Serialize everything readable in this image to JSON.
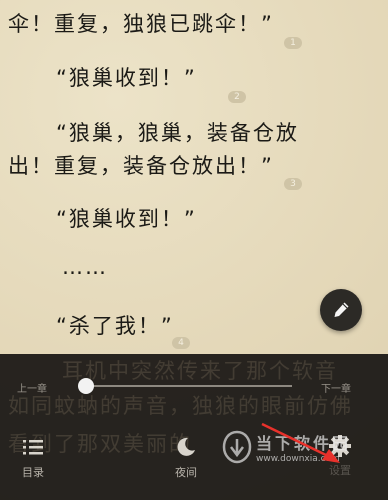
{
  "reader": {
    "lines": [
      "伞！重复，独狼已跳伞！”",
      "“狼巢收到！”",
      "“狼巢，狼巢，装备仓放",
      "出！重复，装备仓放出！”",
      "“狼巢收到！”",
      "……",
      "“杀了我！”"
    ],
    "para_numbers": [
      "1",
      "2",
      "3",
      "4"
    ],
    "hidden_lines": [
      "耳机中突然传来了那个软音",
      "如同蚊蚋的声音，独狼的眼前仿佛",
      "看到了那双美丽的"
    ]
  },
  "controls": {
    "prev_chapter": "上一章",
    "next_chapter": "下一章",
    "progress": 0.0,
    "menu": [
      {
        "icon": "list-icon",
        "label": "目录"
      },
      {
        "icon": "moon-icon",
        "label": "夜间"
      },
      {
        "icon": "gear-icon",
        "label": "设置"
      }
    ]
  },
  "watermark": {
    "name": "当下软件园",
    "url": "www.downxia.com"
  },
  "colors": {
    "paper": "#e7dcbf",
    "panel": "#12100e",
    "arrow": "#e8312b"
  }
}
